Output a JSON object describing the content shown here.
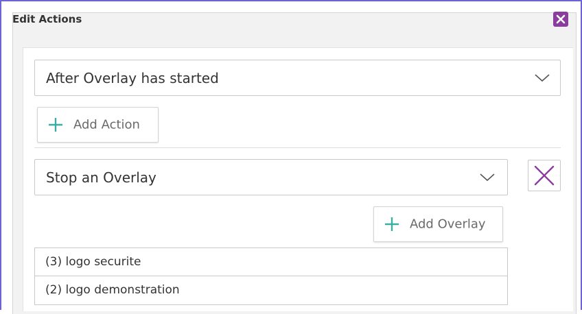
{
  "dialog": {
    "title": "Edit Actions",
    "close_icon": "close-icon"
  },
  "trigger": {
    "selected": "After Overlay has started"
  },
  "add_action": {
    "label": "Add Action",
    "icon": "plus-icon"
  },
  "action": {
    "selected": "Stop an Overlay",
    "remove_icon": "x-icon"
  },
  "add_overlay": {
    "label": "Add Overlay",
    "icon": "plus-icon"
  },
  "overlays": [
    "(3) logo securite",
    "(2) logo demonstration"
  ],
  "colors": {
    "frame": "#6b63d6",
    "accent_purple": "#8b3d9e",
    "plus_teal": "#3aaea3"
  }
}
